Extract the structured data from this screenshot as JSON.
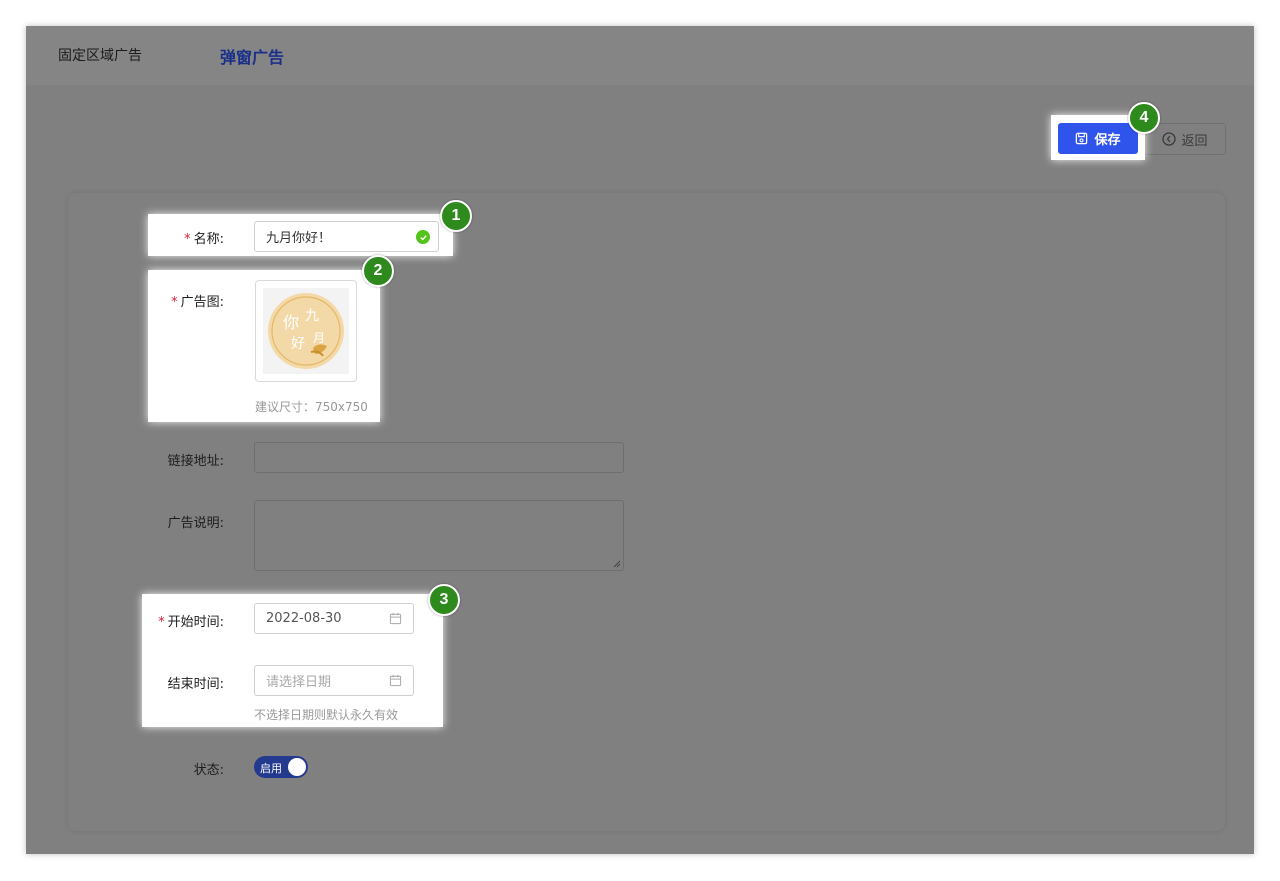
{
  "tabs": [
    {
      "label": "固定区域广告",
      "active": false
    },
    {
      "label": "弹窗广告",
      "active": true
    }
  ],
  "toolbar": {
    "save_label": "保存",
    "back_label": "返回"
  },
  "form": {
    "name": {
      "label": "名称:",
      "value": "九月你好！",
      "required": true
    },
    "image": {
      "label": "广告图:",
      "hint": "建议尺寸：750x750",
      "required": true,
      "image_text_1": "你",
      "image_text_2": "九",
      "image_text_3": "好",
      "image_text_4": "月"
    },
    "link": {
      "label": "链接地址:",
      "value": ""
    },
    "description": {
      "label": "广告说明:",
      "value": ""
    },
    "start_time": {
      "label": "开始时间:",
      "value": "2022-08-30",
      "required": true
    },
    "end_time": {
      "label": "结束时间:",
      "placeholder": "请选择日期",
      "hint": "不选择日期则默认永久有效"
    },
    "status": {
      "label": "状态:",
      "toggle_label": "启用",
      "on": true
    }
  },
  "badges": [
    "1",
    "2",
    "3",
    "4"
  ],
  "colors": {
    "primary": "#2f54eb",
    "badge": "#2f8a1e",
    "required": "#d4213a",
    "success": "#52c41a",
    "overlay": "#808080"
  }
}
